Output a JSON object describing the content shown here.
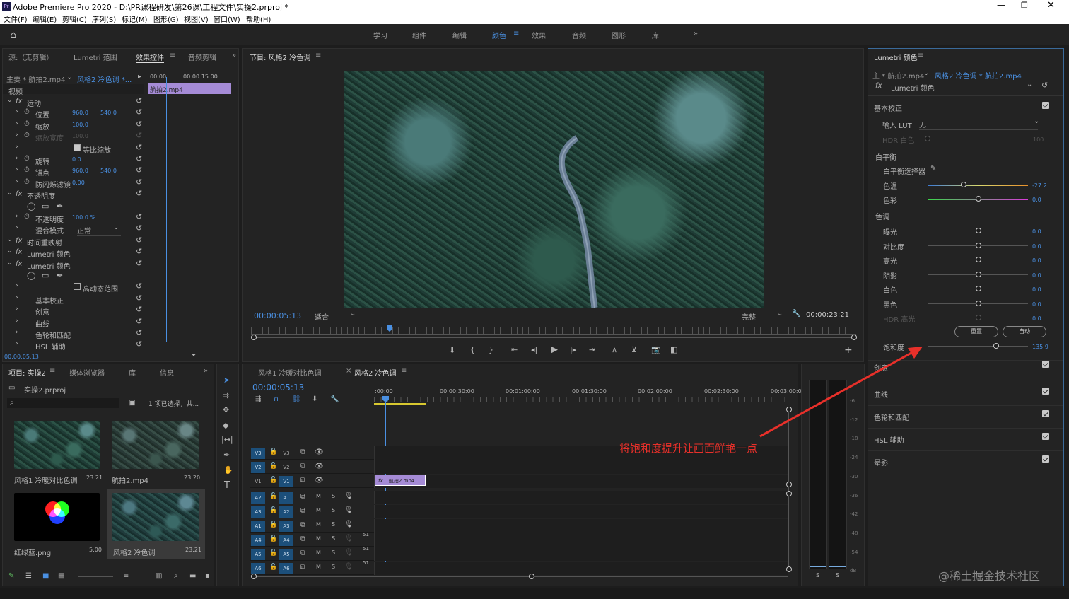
{
  "window": {
    "title": "Adobe Premiere Pro 2020 - D:\\PR课程研发\\第26课\\工程文件\\实操2.prproj *",
    "app_badge": "Pr"
  },
  "menu": [
    "文件(F)",
    "编辑(E)",
    "剪辑(C)",
    "序列(S)",
    "标记(M)",
    "图形(G)",
    "视图(V)",
    "窗口(W)",
    "帮助(H)"
  ],
  "workspaces": [
    "学习",
    "组件",
    "编辑",
    "颜色",
    "效果",
    "音频",
    "图形",
    "库"
  ],
  "active_workspace": "颜色",
  "effect_controls": {
    "tabs": [
      "源:（无剪辑）",
      "Lumetri 范围",
      "效果控件",
      "音频剪辑"
    ],
    "master_clip": "主要 * 航拍2.mp4",
    "sequence_clip": "风格2 冷色调 *...",
    "timecode_start": "00:00",
    "timecode_end": "00:00:15:00",
    "clip_name": "航拍2.mp4",
    "section_video": "视频",
    "rows": [
      {
        "label": "运动",
        "fx": true
      },
      {
        "label": "位置",
        "v1": "960.0",
        "v2": "540.0"
      },
      {
        "label": "缩放",
        "v1": "100.0"
      },
      {
        "label": "缩放宽度",
        "v1": "100.0",
        "dim": true
      },
      {
        "label": "等比缩放",
        "check": true
      },
      {
        "label": "旋转",
        "v1": "0.0"
      },
      {
        "label": "锚点",
        "v1": "960.0",
        "v2": "540.0"
      },
      {
        "label": "防闪烁滤镜",
        "v1": "0.00"
      },
      {
        "label": "不透明度",
        "fx": true
      },
      {
        "label": "masks"
      },
      {
        "label": "不透明度",
        "v1": "100.0 %"
      },
      {
        "label": "混合模式",
        "v1": "正常"
      },
      {
        "label": "时间重映射",
        "fx": true
      },
      {
        "label": "Lumetri 颜色",
        "fx": true
      },
      {
        "label": "Lumetri 颜色",
        "fx": true
      },
      {
        "label": "masks"
      },
      {
        "label": "高动态范围",
        "check": false
      },
      {
        "label": "基本校正"
      },
      {
        "label": "创意"
      },
      {
        "label": "曲线"
      },
      {
        "label": "色轮和匹配"
      },
      {
        "label": "HSL 辅助"
      }
    ],
    "current_time": "00:00:05:13"
  },
  "program": {
    "title": "节目: 风格2 冷色调",
    "timecode": "00:00:05:13",
    "fit": "适合",
    "quality": "完整",
    "duration": "00:00:23:21"
  },
  "lumetri": {
    "title": "Lumetri 颜色",
    "master": "主 * 航拍2.mp4",
    "clip": "风格2 冷色调 * 航拍2.mp4",
    "fx": "Lumetri 颜色",
    "basic": "基本校正",
    "input_lut_label": "输入 LUT",
    "input_lut": "无",
    "hdr_white": "HDR 白色",
    "hdr_white_val": "100",
    "white_balance": "白平衡",
    "wb_selector": "白平衡选择器",
    "sliders": [
      {
        "label": "色温",
        "value": "-27.2",
        "pos": 0.36
      },
      {
        "label": "色彩",
        "value": "0.0",
        "pos": 0.5
      }
    ],
    "tone": "色调",
    "tone_sliders": [
      {
        "label": "曝光",
        "value": "0.0"
      },
      {
        "label": "对比度",
        "value": "0.0"
      },
      {
        "label": "高光",
        "value": "0.0"
      },
      {
        "label": "阴影",
        "value": "0.0"
      },
      {
        "label": "白色",
        "value": "0.0"
      },
      {
        "label": "黑色",
        "value": "0.0"
      },
      {
        "label": "HDR 高光",
        "value": "0.0",
        "dim": true
      }
    ],
    "reset": "重置",
    "auto": "自动",
    "saturation": "饱和度",
    "saturation_value": "135.9",
    "saturation_pos": 0.68,
    "sections": [
      "创意",
      "曲线",
      "色轮和匹配",
      "HSL 辅助",
      "晕影"
    ]
  },
  "project": {
    "tabs": [
      "项目: 实操2",
      "媒体浏览器",
      "库",
      "信息"
    ],
    "file": "实操2.prproj",
    "selection": "1 项已选择，共...",
    "items": [
      {
        "name": "风格1 冷暖对比色调",
        "dur": "23:21"
      },
      {
        "name": "航拍2.mp4",
        "dur": "23:20"
      },
      {
        "name": "红绿蓝.png",
        "dur": "5:00"
      },
      {
        "name": "风格2 冷色调",
        "dur": "23:21"
      }
    ]
  },
  "timeline": {
    "tabs": [
      "风格1 冷暖对比色调",
      "风格2 冷色调"
    ],
    "timecode": "00:00:05:13",
    "ruler": [
      ":00:00",
      "00:00:30:00",
      "00:01:00:00",
      "00:01:30:00",
      "00:02:00:00",
      "00:02:30:00",
      "00:03:00:00"
    ],
    "clip": "航拍2.mp4",
    "video_tracks": [
      "V3",
      "V2",
      "V1"
    ],
    "audio_tracks": [
      "A1",
      "A2",
      "A3",
      "A4",
      "A5",
      "A6"
    ],
    "source_audio": [
      "A2",
      "A3",
      "A1",
      "A4",
      "A5",
      "A6"
    ],
    "audio_level": "51"
  },
  "meter": {
    "scale": [
      "-6",
      "-12",
      "-18",
      "-24",
      "-30",
      "-36",
      "-42",
      "-48",
      "-54",
      "dB"
    ],
    "labels": [
      "S",
      "S"
    ]
  },
  "annotation": {
    "text": "将饱和度提升让画面鲜艳一点",
    "color": "#e8302a"
  },
  "watermark": "@稀土掘金技术社区"
}
